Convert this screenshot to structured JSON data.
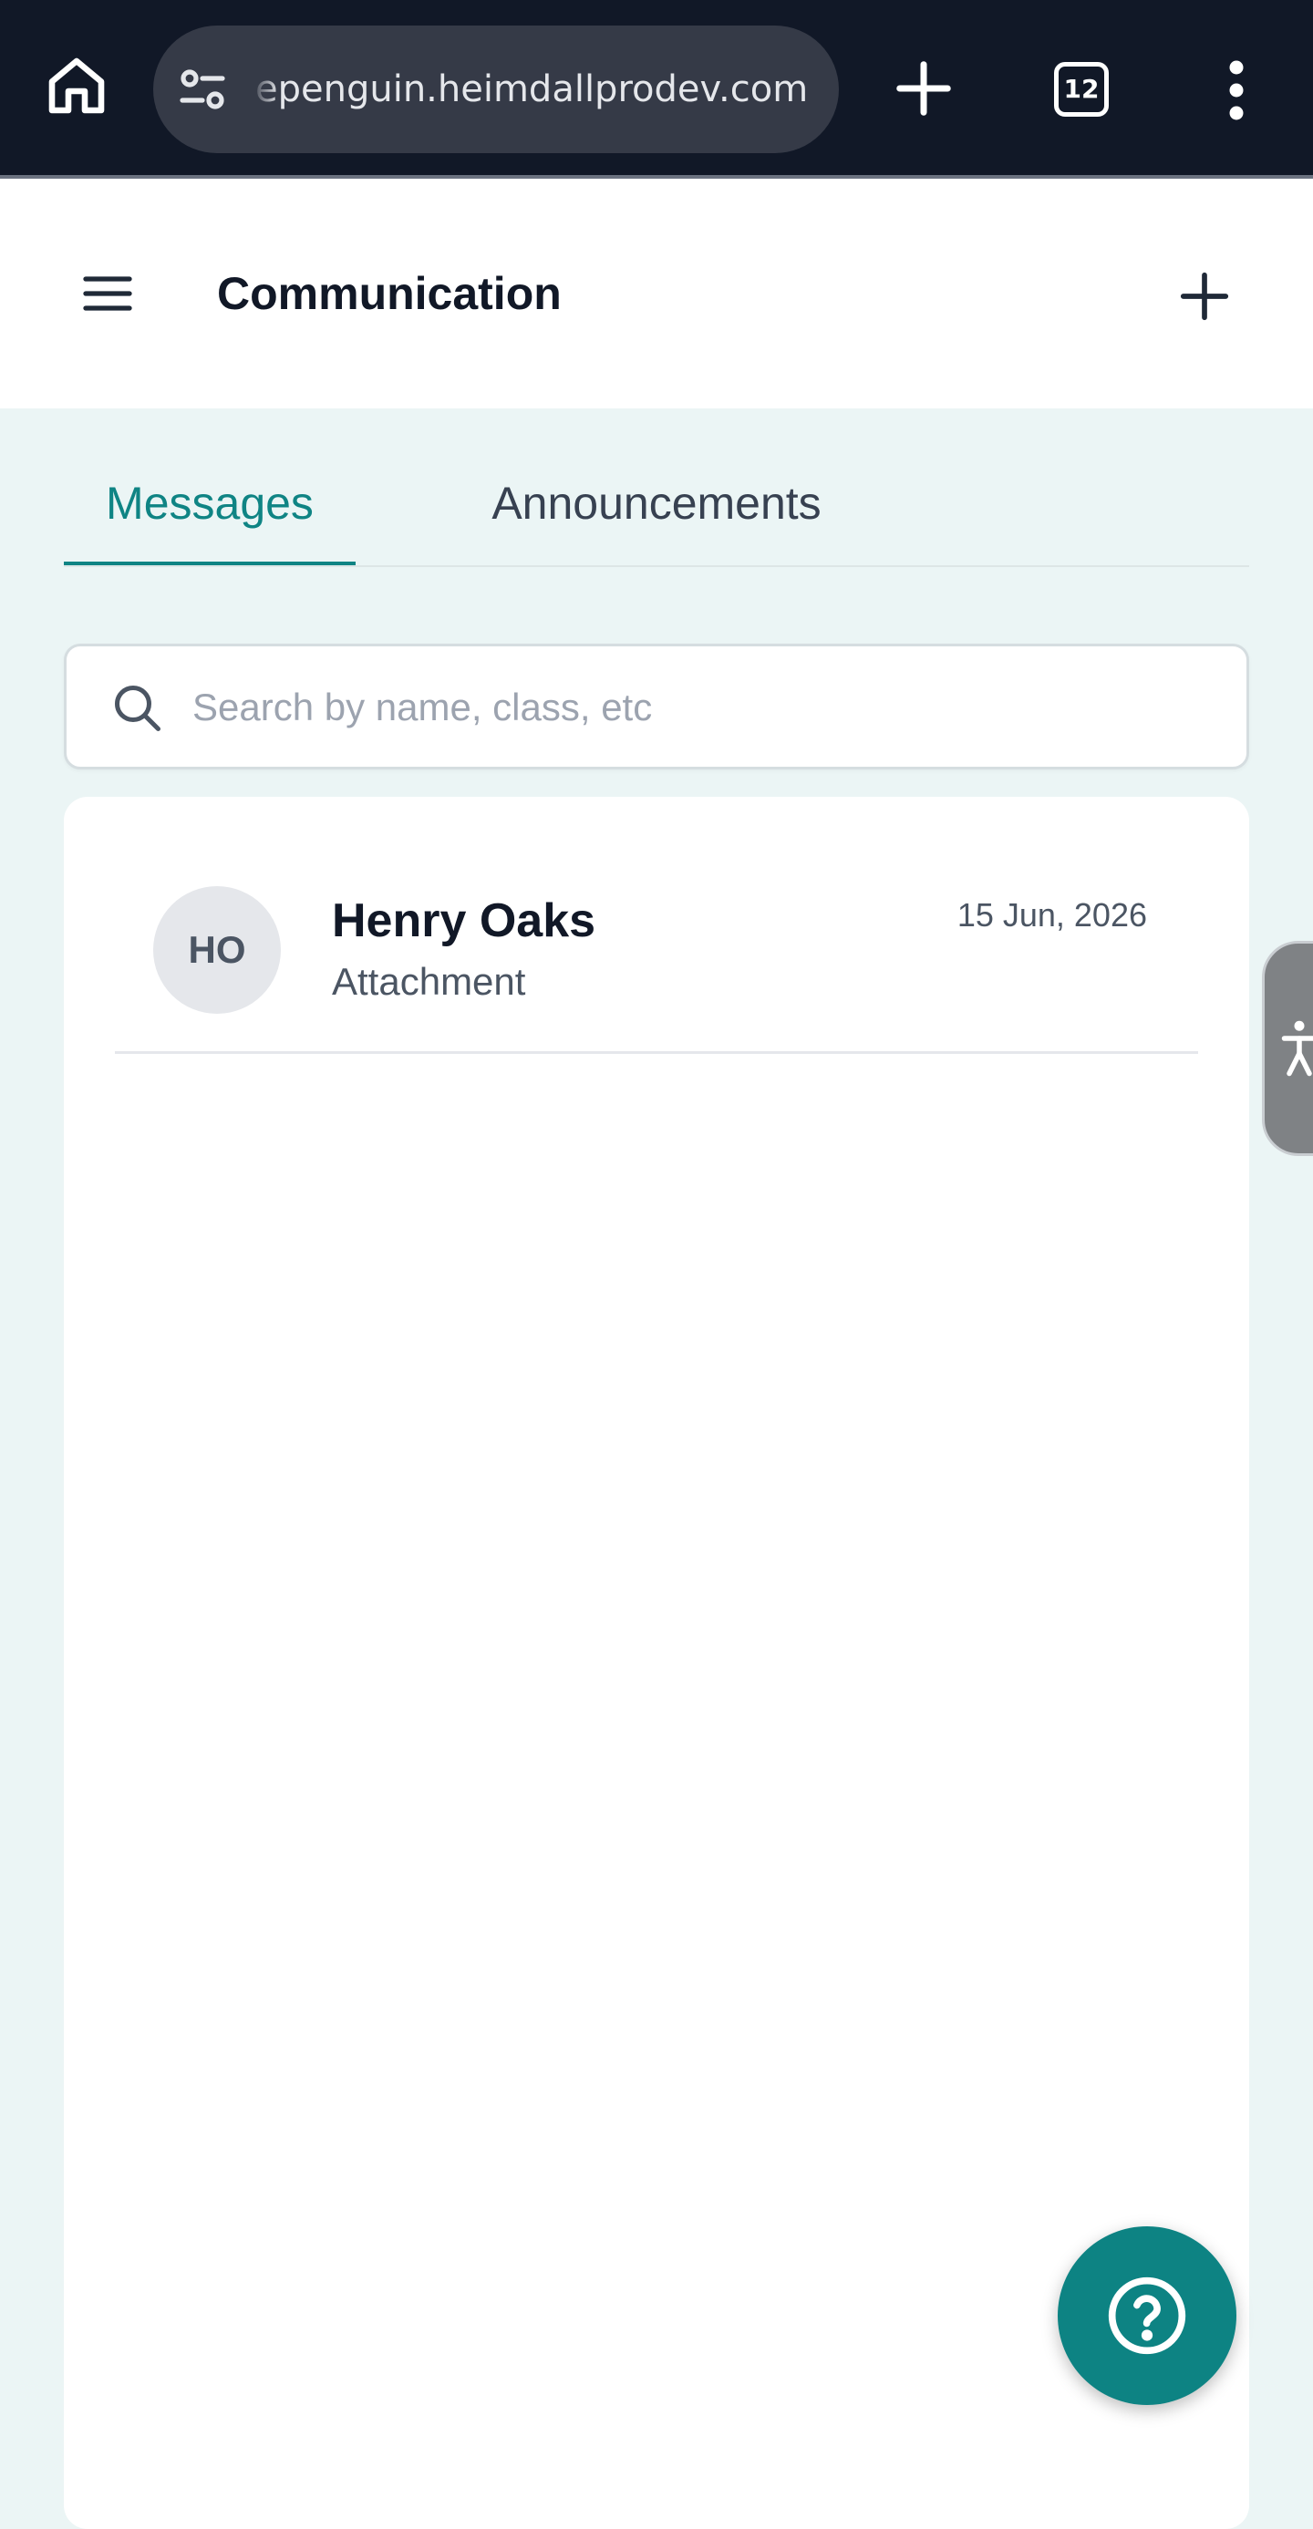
{
  "browser": {
    "url": "epenguin.heimdallprodev.com",
    "tab_count": "12"
  },
  "header": {
    "title": "Communication"
  },
  "tabs": [
    {
      "label": "Messages",
      "active": true
    },
    {
      "label": "Announcements",
      "active": false
    }
  ],
  "search": {
    "placeholder": "Search by name, class, etc",
    "value": ""
  },
  "messages": [
    {
      "initials": "HO",
      "name": "Henry Oaks",
      "preview": "Attachment",
      "date": "15 Jun, 2026"
    }
  ],
  "icons": {
    "home": "home-icon",
    "site_settings": "tune-icon",
    "new_tab": "plus-icon",
    "browser_menu": "more-vertical-icon",
    "nav_menu": "hamburger-icon",
    "compose": "plus-icon",
    "search": "search-icon",
    "accessibility": "accessibility-icon",
    "help": "help-circle-icon"
  },
  "colors": {
    "accent": "#0f8484",
    "page_background": "#ebf5f5",
    "browser_bar": "#111827"
  }
}
